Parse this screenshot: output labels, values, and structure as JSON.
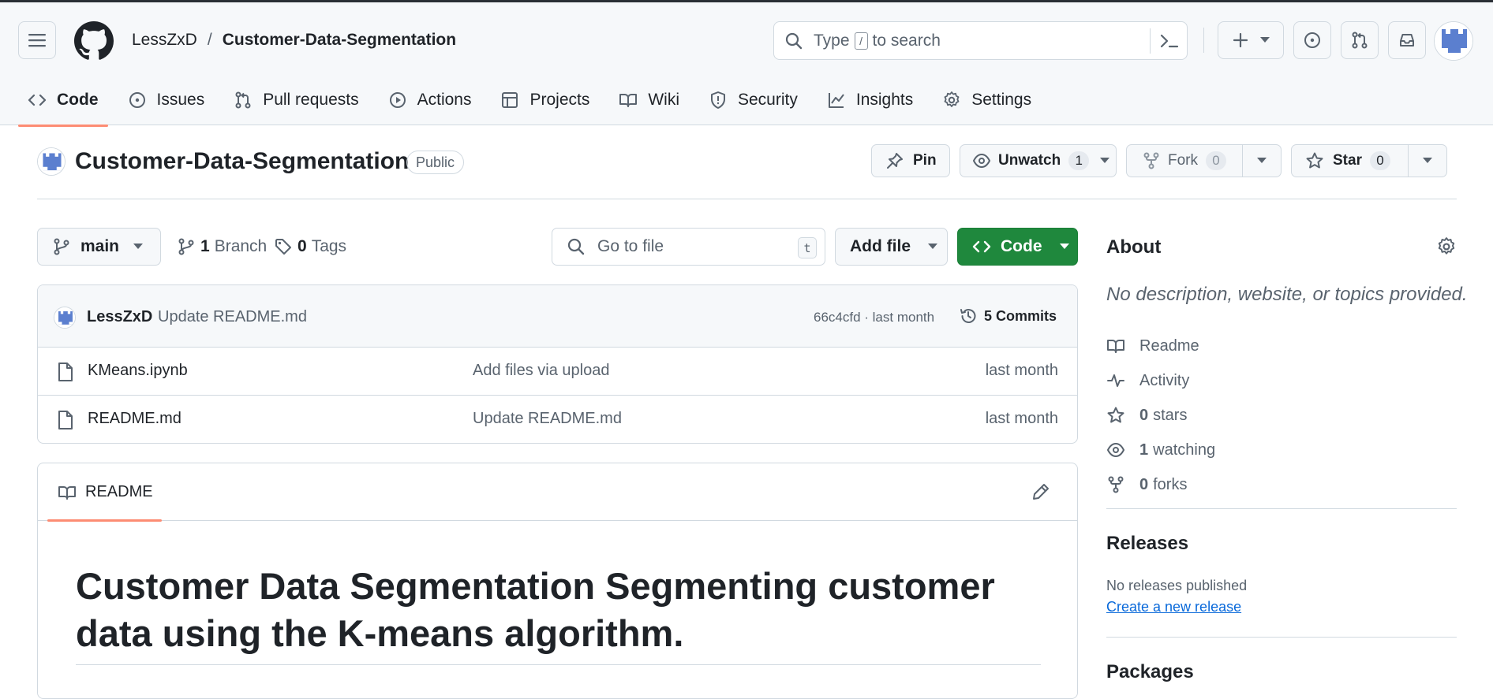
{
  "header": {
    "owner": "LessZxD",
    "separator": "/",
    "repo": "Customer-Data-Segmentation",
    "search_before": "Type",
    "search_key": "/",
    "search_after": "to search"
  },
  "tabs": [
    {
      "label": "Code",
      "icon": "code-icon",
      "active": true
    },
    {
      "label": "Issues",
      "icon": "issue-icon"
    },
    {
      "label": "Pull requests",
      "icon": "pull-request-icon"
    },
    {
      "label": "Actions",
      "icon": "play-icon"
    },
    {
      "label": "Projects",
      "icon": "table-icon"
    },
    {
      "label": "Wiki",
      "icon": "book-icon"
    },
    {
      "label": "Security",
      "icon": "shield-icon"
    },
    {
      "label": "Insights",
      "icon": "graph-icon"
    },
    {
      "label": "Settings",
      "icon": "gear-icon"
    }
  ],
  "repo": {
    "title": "Customer-Data-Segmentation",
    "visibility": "Public",
    "pin_label": "Pin",
    "watch_label": "Unwatch",
    "watch_count": "1",
    "fork_label": "Fork",
    "fork_count": "0",
    "star_label": "Star",
    "star_count": "0"
  },
  "branch": {
    "name": "main",
    "branch_count": "1",
    "branch_label": "Branch",
    "tag_count": "0",
    "tag_label": "Tags",
    "goto_placeholder": "Go to file",
    "goto_key": "t",
    "add_file_label": "Add file",
    "code_label": "Code"
  },
  "commit": {
    "user": "LessZxD",
    "message": "Update README.md",
    "hash_time": "66c4cfd · last month",
    "commits_label": "5 Commits"
  },
  "files": [
    {
      "name": "KMeans.ipynb",
      "message": "Add files via upload",
      "time": "last month"
    },
    {
      "name": "README.md",
      "message": "Update README.md",
      "time": "last month"
    }
  ],
  "readme": {
    "tab_label": "README",
    "heading": "Customer Data Segmentation Segmenting customer data using the K-means algorithm."
  },
  "about": {
    "title": "About",
    "description": "No description, website, or topics provided.",
    "readme_label": "Readme",
    "activity_label": "Activity",
    "stars_count": "0",
    "stars_label": "stars",
    "watching_count": "1",
    "watching_label": "watching",
    "forks_count": "0",
    "forks_label": "forks"
  },
  "releases": {
    "title": "Releases",
    "none_text": "No releases published",
    "create_link": "Create a new release"
  },
  "packages": {
    "title": "Packages"
  },
  "colors": {
    "accent_green": "#1f883d",
    "tab_underline": "#fd8c73",
    "link_blue": "#0969da",
    "avatar_blue": "#5b7fcf"
  }
}
